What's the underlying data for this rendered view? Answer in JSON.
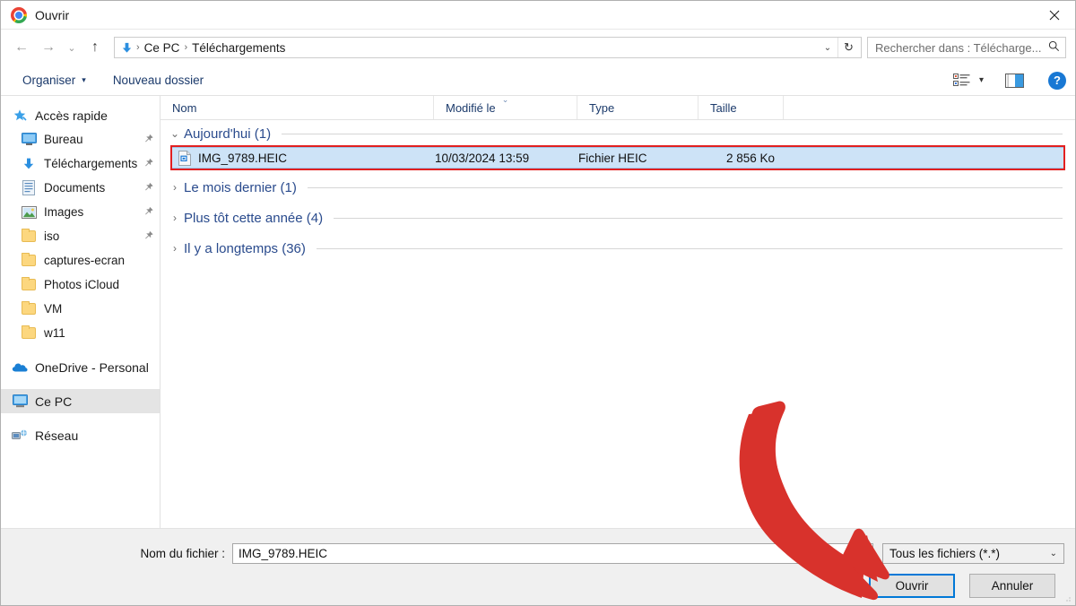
{
  "window": {
    "title": "Ouvrir",
    "app_icon": "chrome-icon",
    "close_label": "✕"
  },
  "nav": {
    "back_icon": "←",
    "forward_icon": "→",
    "recent_icon": "⌄",
    "up_icon": "↑",
    "refresh_icon": "↻",
    "dropdown_icon": "⌄",
    "breadcrumb_icon": "download-arrow-icon",
    "breadcrumb": [
      "Ce PC",
      "Téléchargements"
    ],
    "separator": "›"
  },
  "search": {
    "placeholder": "Rechercher dans : Télécharge...",
    "icon": "search-icon"
  },
  "toolbar": {
    "organize_label": "Organiser",
    "organize_caret": "▾",
    "new_folder_label": "Nouveau dossier",
    "view_icon": "list-view-icon",
    "view_caret": "▾",
    "preview_icon": "preview-pane-icon",
    "help_icon": "?"
  },
  "sidebar": {
    "items": [
      {
        "label": "Accès rapide",
        "icon": "star-pin-icon",
        "level": "root",
        "pinned": false,
        "selected": false
      },
      {
        "label": "Bureau",
        "icon": "desktop-icon",
        "level": "child",
        "pinned": true,
        "selected": false
      },
      {
        "label": "Téléchargements",
        "icon": "download-arrow-icon",
        "level": "child",
        "pinned": true,
        "selected": false
      },
      {
        "label": "Documents",
        "icon": "documents-icon",
        "level": "child",
        "pinned": true,
        "selected": false
      },
      {
        "label": "Images",
        "icon": "pictures-icon",
        "level": "child",
        "pinned": true,
        "selected": false
      },
      {
        "label": "iso",
        "icon": "folder-icon",
        "level": "child",
        "pinned": true,
        "selected": false
      },
      {
        "label": "captures-ecran",
        "icon": "folder-icon",
        "level": "child",
        "pinned": false,
        "selected": false
      },
      {
        "label": "Photos iCloud",
        "icon": "folder-icon",
        "level": "child",
        "pinned": false,
        "selected": false
      },
      {
        "label": "VM",
        "icon": "folder-icon",
        "level": "child",
        "pinned": false,
        "selected": false
      },
      {
        "label": "w11",
        "icon": "folder-icon",
        "level": "child",
        "pinned": false,
        "selected": false
      }
    ],
    "roots": [
      {
        "label": "OneDrive - Personal",
        "icon": "onedrive-cloud-icon",
        "selected": false
      },
      {
        "label": "Ce PC",
        "icon": "this-pc-icon",
        "selected": true
      },
      {
        "label": "Réseau",
        "icon": "network-icon",
        "selected": false
      }
    ]
  },
  "columns": {
    "name": "Nom",
    "date": "Modifié le",
    "type": "Type",
    "size": "Taille",
    "sorted_by": "Modifié le",
    "sort_mark": "⌄"
  },
  "groups": [
    {
      "label": "Aujourd'hui (1)",
      "expanded": true,
      "chevron": "⌄",
      "rows": [
        {
          "name": "IMG_9789.HEIC",
          "date": "10/03/2024 13:59",
          "type": "Fichier HEIC",
          "size": "2 856 Ko",
          "icon": "heic-file-icon",
          "selected": true,
          "highlight_color": "#e22020"
        }
      ]
    },
    {
      "label": "Le mois dernier (1)",
      "expanded": false,
      "chevron": "›",
      "rows": []
    },
    {
      "label": "Plus tôt cette année (4)",
      "expanded": false,
      "chevron": "›",
      "rows": []
    },
    {
      "label": "Il y a longtemps (36)",
      "expanded": false,
      "chevron": "›",
      "rows": []
    }
  ],
  "footer": {
    "filename_label": "Nom du fichier :",
    "filename_value": "IMG_9789.HEIC",
    "filter_value": "Tous les fichiers (*.*)",
    "filter_chevron": "⌄",
    "open_label": "Ouvrir",
    "cancel_label": "Annuler"
  },
  "annotation": {
    "arrow_color": "#d8322c",
    "points_to": "Ouvrir"
  },
  "colors": {
    "selection_blue": "#cde3f7",
    "selection_border": "#9cc6ea",
    "focus_blue": "#0078d7",
    "link_blue": "#2a4b8d",
    "panel_gray": "#f0f0f0"
  }
}
